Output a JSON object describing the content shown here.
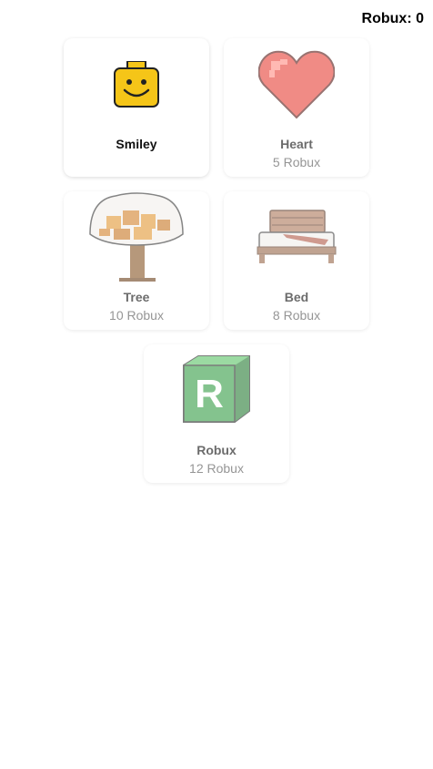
{
  "header": {
    "balance": "Robux: 0"
  },
  "items": [
    {
      "name": "Smiley",
      "price": "",
      "icon": "smiley-icon",
      "owned": true
    },
    {
      "name": "Heart",
      "price": "5 Robux",
      "icon": "heart-icon",
      "owned": false
    },
    {
      "name": "Tree",
      "price": "10 Robux",
      "icon": "tree-icon",
      "owned": false
    },
    {
      "name": "Bed",
      "price": "8 Robux",
      "icon": "bed-icon",
      "owned": false
    },
    {
      "name": "Robux",
      "price": "12 Robux",
      "icon": "robux-cube-icon",
      "owned": false
    }
  ],
  "colors": {
    "smiley": "#f5c518",
    "heart": "#e8453c",
    "tree_trunk": "#8b5a2b",
    "tree_leaves": "#e39a3a",
    "bed_wood": "#9a6b4f",
    "robux_green": "#3aa04a"
  }
}
